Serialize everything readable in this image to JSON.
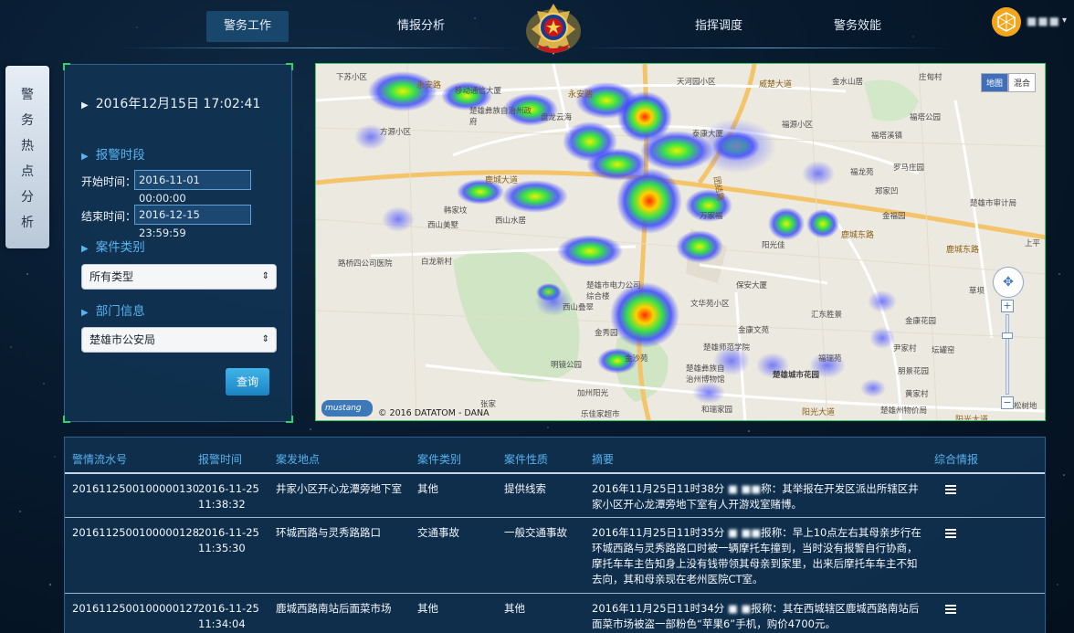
{
  "nav": {
    "items": [
      {
        "label": "警务工作",
        "active": true
      },
      {
        "label": "情报分析",
        "active": false
      },
      {
        "label": "指挥调度",
        "active": false
      },
      {
        "label": "警务效能",
        "active": false
      }
    ],
    "user": {
      "name": "■■■",
      "caret": "▾"
    }
  },
  "side_tab": {
    "label": [
      "警",
      "务",
      "热",
      "点",
      "分",
      "析"
    ]
  },
  "query_panel": {
    "datetime": "2016年12月15日 17:02:41",
    "alarm_period": {
      "title": "报警时段",
      "start_label": "开始时间：",
      "start_value": "2016-11-01 00:00:00",
      "end_label": "结束时间：",
      "end_value": "2016-12-15 23:59:59"
    },
    "case_type": {
      "title": "案件类别",
      "selected": "所有类型"
    },
    "department": {
      "title": "部门信息",
      "selected": "楚雄市公安局"
    },
    "query_button": "查询"
  },
  "map": {
    "mode_options": [
      "地图",
      "混合"
    ],
    "active_mode": "地图",
    "credit": "© 2016 DATATOM - DANA",
    "logo": "mustang",
    "zoom_plus": "+",
    "zoom_minus": "−",
    "labels": [
      "下苏小区",
      "永安路",
      "移动通信大厦",
      "永安路",
      "天河园小区",
      "威楚大道",
      "金水山居",
      "庄甸村",
      "楚雄彝族自治州政府",
      "盘龙云海",
      "福塔公园",
      "方源小区",
      "泰康大厦",
      "福源小区",
      "福塔溪镇",
      "福龙苑",
      "罗马庄园",
      "鹿城大道",
      "韩家坟",
      "西山美墅",
      "西山水居",
      "郑家凹",
      "楚雄市审计局",
      "金福园",
      "万家福",
      "阳光佳",
      "鹿城东路",
      "鹿城东路",
      "上平",
      "路桥四公司医院",
      "白龙新村",
      "团结路",
      "楚雄市电力公司综合楼",
      "保安大厦",
      "西山叠翠",
      "文华苑小区",
      "汇东胜景",
      "金康花园",
      "金秀园",
      "金康文苑",
      "楚雄师范学院",
      "尹家村",
      "坛罐窑",
      "金沙苑",
      "福瑞苑",
      "楚雄彝族自治州博物馆",
      "楚雄城市花园",
      "朋景花园",
      "黄家村",
      "草坝",
      "明镜公园",
      "加州阳光",
      "张家",
      "乐佳家超市",
      "和瑞家园",
      "阳光大道",
      "楚雄州物价局",
      "阳光大道",
      "松树地"
    ]
  },
  "table": {
    "headers": [
      "警情流水号",
      "报警时间",
      "案发地点",
      "案件类别",
      "案件性质",
      "摘要",
      "综合情报"
    ],
    "rows": [
      {
        "id": "2016112500100000130",
        "time": "2016-11-25 11:38:32",
        "location": "井家小区开心龙潭旁地下室",
        "category": "其他",
        "nature": "提供线索",
        "summary_pre": "2016年11月25日11时38分",
        "summary_redacted": "■ ■■",
        "summary_post": "称：其举报在开发区派出所辖区井家小区开心龙潭旁地下室有人开游戏室赌博。"
      },
      {
        "id": "2016112500100000128",
        "time": "2016-11-25 11:35:30",
        "location": "环城西路与灵秀路路口",
        "category": "交通事故",
        "nature": "一般交通事故",
        "summary_pre": "2016年11月25日11时35分",
        "summary_redacted": "■ ■■",
        "summary_post": "报称：早上10点左右其母亲步行在环城西路与灵秀路路口时被一辆摩托车撞到，当时没有报警自行协商，摩托车车主告知身上没有钱带领其母亲到家里，出来后摩托车车主不知去向，其和母亲现在老州医院CT室。"
      },
      {
        "id": "2016112500100000127",
        "time": "2016-11-25 11:34:04",
        "location": "鹿城西路南站后面菜市场",
        "category": "其他",
        "nature": "其他",
        "summary_pre": "2016年11月25日11时34分",
        "summary_redacted": "■ ■",
        "summary_post": "报称：其在西城辖区鹿城西路南站后面菜市场被盗一部粉色“苹果6”手机，购价4700元。"
      }
    ]
  },
  "colors": {
    "accent_blue": "#58b4f0",
    "panel_bg": "#113454",
    "frame_green": "#2fd36a",
    "button_blue": "#1c84c4"
  }
}
